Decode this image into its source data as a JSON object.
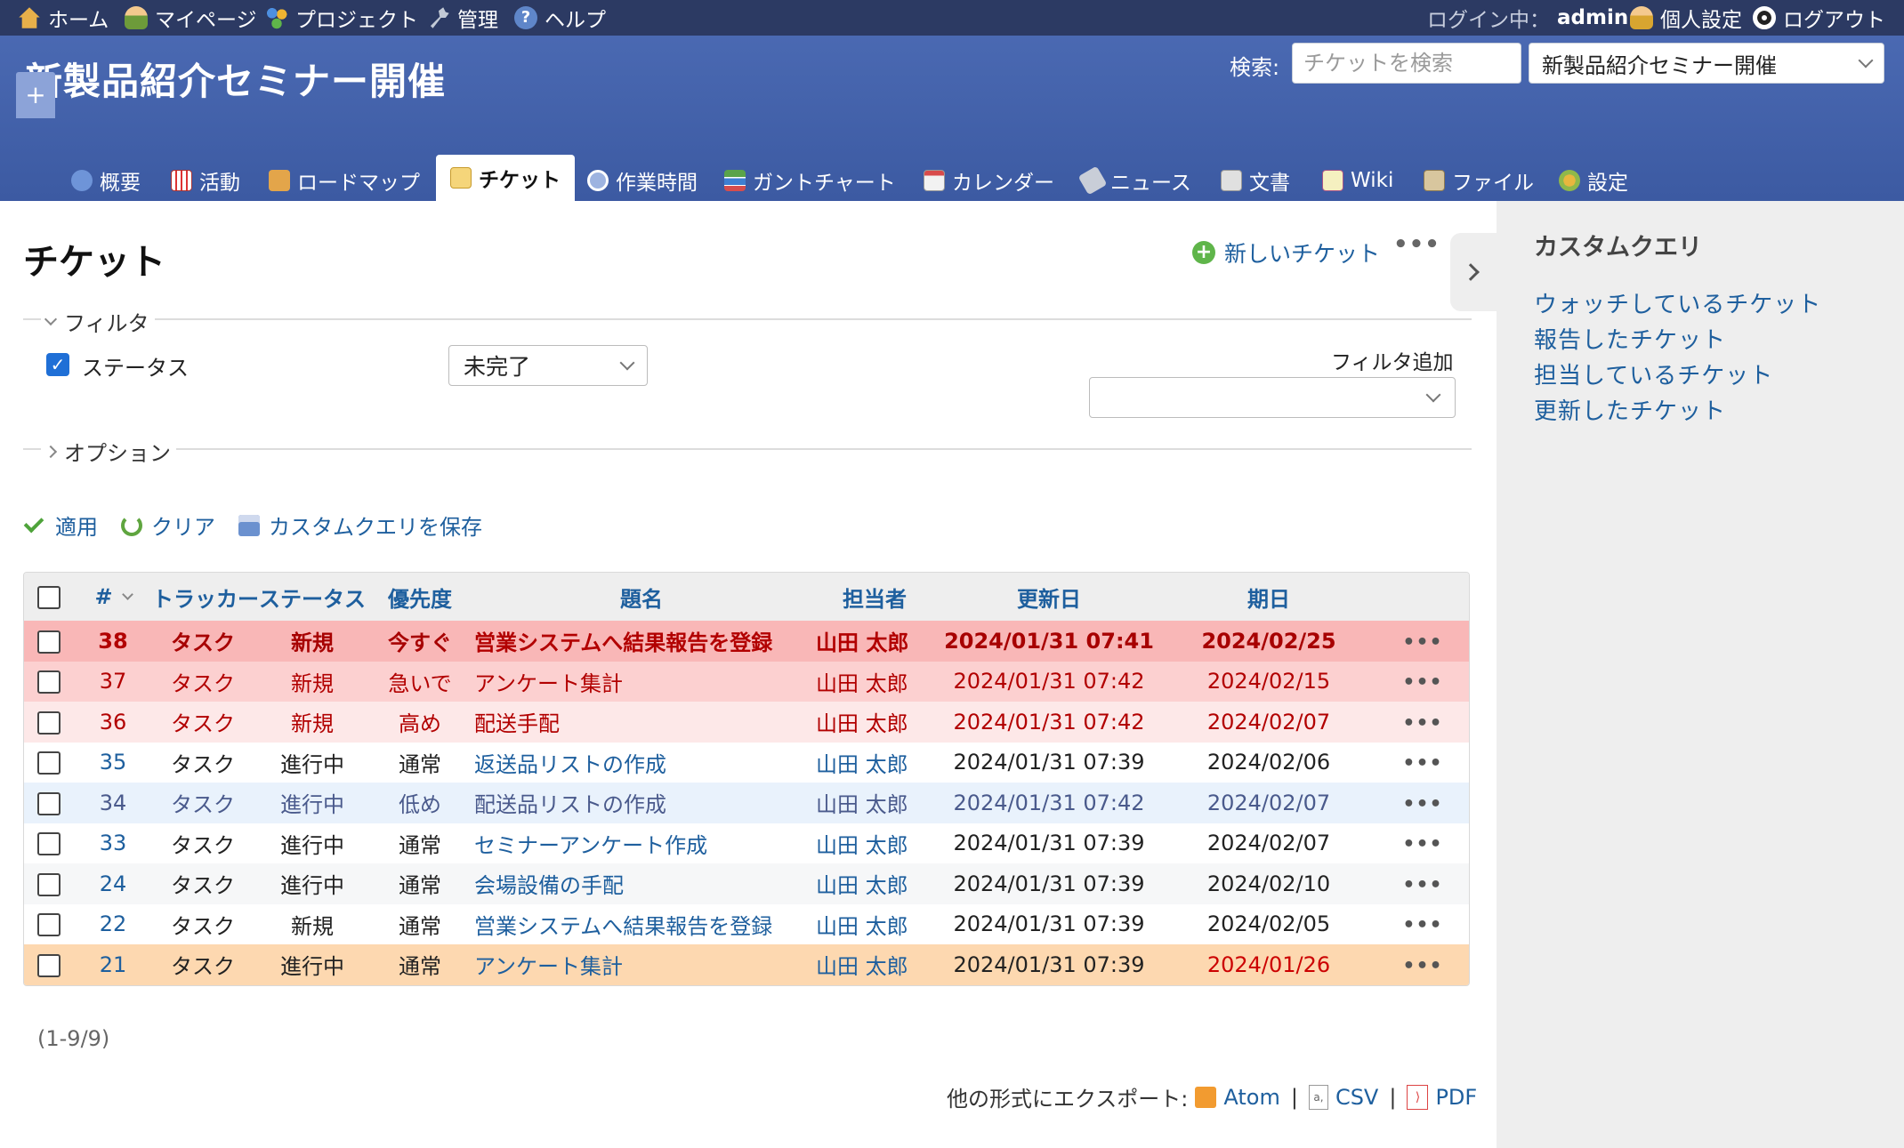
{
  "top_menu": {
    "home": "ホーム",
    "my_page": "マイページ",
    "projects": "プロジェクト",
    "admin": "管理",
    "help": "ヘルプ",
    "logged_in_label": "ログイン中：",
    "logged_in_user": "admin",
    "my_account": "個人設定",
    "logout": "ログアウト"
  },
  "header": {
    "project_title": "新製品紹介セミナー開催",
    "search_label": "検索:",
    "search_placeholder": "チケットを検索",
    "project_jump_value": "新製品紹介セミナー開催"
  },
  "tabs": {
    "new": "+",
    "overview": "概要",
    "activity": "活動",
    "roadmap": "ロードマップ",
    "issues": "チケット",
    "time_entries": "作業時間",
    "gantt": "ガントチャート",
    "calendar": "カレンダー",
    "news": "ニュース",
    "documents": "文書",
    "wiki": "Wiki",
    "files": "ファイル",
    "settings": "設定",
    "selected": "issues"
  },
  "main": {
    "title": "チケット",
    "new_issue": "新しいチケット",
    "more": "•••",
    "filters_legend": "フィルタ",
    "status_filter_label": "ステータス",
    "status_filter_value": "未完了",
    "add_filter_label": "フィルタ追加",
    "options_legend": "オプション",
    "apply": "適用",
    "clear": "クリア",
    "save_query": "カスタムクエリを保存"
  },
  "table": {
    "columns": [
      "#",
      "トラッカー",
      "ステータス",
      "優先度",
      "題名",
      "担当者",
      "更新日",
      "期日"
    ],
    "rows": [
      {
        "id": "38",
        "tracker": "タスク",
        "status": "新規",
        "priority": "今すぐ",
        "subject": "営業システムへ結果報告を登録",
        "assignee": "山田 太郎",
        "updated": "2024/01/31 07:41",
        "due": "2024/02/25",
        "more": "•••"
      },
      {
        "id": "37",
        "tracker": "タスク",
        "status": "新規",
        "priority": "急いで",
        "subject": "アンケート集計",
        "assignee": "山田 太郎",
        "updated": "2024/01/31 07:42",
        "due": "2024/02/15",
        "more": "•••"
      },
      {
        "id": "36",
        "tracker": "タスク",
        "status": "新規",
        "priority": "高め",
        "subject": "配送手配",
        "assignee": "山田 太郎",
        "updated": "2024/01/31 07:42",
        "due": "2024/02/07",
        "more": "•••"
      },
      {
        "id": "35",
        "tracker": "タスク",
        "status": "進行中",
        "priority": "通常",
        "subject": "返送品リストの作成",
        "assignee": "山田 太郎",
        "updated": "2024/01/31 07:39",
        "due": "2024/02/06",
        "more": "•••"
      },
      {
        "id": "34",
        "tracker": "タスク",
        "status": "進行中",
        "priority": "低め",
        "subject": "配送品リストの作成",
        "assignee": "山田 太郎",
        "updated": "2024/01/31 07:42",
        "due": "2024/02/07",
        "more": "•••"
      },
      {
        "id": "33",
        "tracker": "タスク",
        "status": "進行中",
        "priority": "通常",
        "subject": "セミナーアンケート作成",
        "assignee": "山田 太郎",
        "updated": "2024/01/31 07:39",
        "due": "2024/02/07",
        "more": "•••"
      },
      {
        "id": "24",
        "tracker": "タスク",
        "status": "進行中",
        "priority": "通常",
        "subject": "会場設備の手配",
        "assignee": "山田 太郎",
        "updated": "2024/01/31 07:39",
        "due": "2024/02/10",
        "more": "•••"
      },
      {
        "id": "22",
        "tracker": "タスク",
        "status": "新規",
        "priority": "通常",
        "subject": "営業システムへ結果報告を登録",
        "assignee": "山田 太郎",
        "updated": "2024/01/31 07:39",
        "due": "2024/02/05",
        "more": "•••"
      },
      {
        "id": "21",
        "tracker": "タスク",
        "status": "進行中",
        "priority": "通常",
        "subject": "アンケート集計",
        "assignee": "山田 太郎",
        "updated": "2024/01/31 07:39",
        "due": "2024/01/26",
        "more": "•••"
      }
    ],
    "count": "(1-9/9)"
  },
  "export": {
    "label": "他の形式にエクスポート:",
    "atom": "Atom",
    "csv": "CSV",
    "pdf": "PDF",
    "separator": "|"
  },
  "sidebar": {
    "title": "カスタムクエリ",
    "queries": [
      "ウォッチしているチケット",
      "報告したチケット",
      "担当しているチケット",
      "更新したチケット"
    ]
  },
  "colors": {
    "top_bar": "#2c3a63",
    "header": "#4a69b2",
    "link": "#1e5f9e",
    "priority_immediate": "#f9b7b7",
    "priority_urgent": "#fcd0d0",
    "priority_high": "#fde8e8",
    "priority_low": "#e9f2fc",
    "overdue": "#fdd8b0"
  }
}
